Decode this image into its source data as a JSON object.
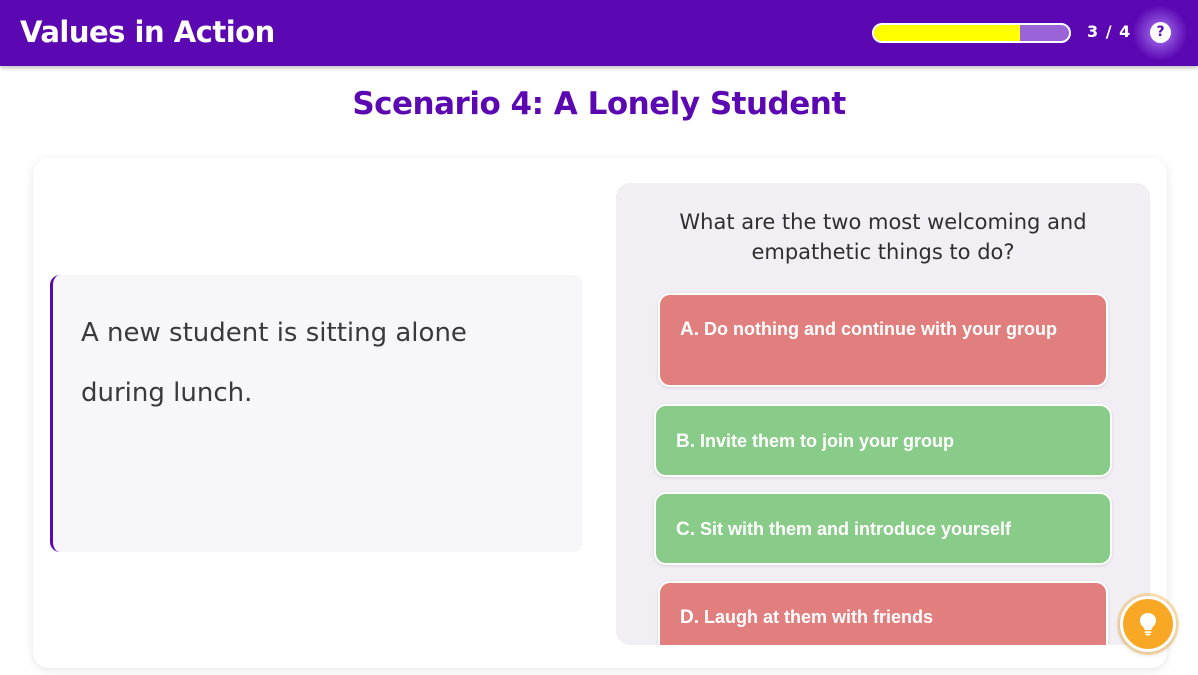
{
  "header": {
    "app_title": "Values in Action",
    "progress": {
      "current": 3,
      "total": 4,
      "fill_fraction": 0.75,
      "label": "3 / 4"
    },
    "help_label": "?"
  },
  "scenario": {
    "title": "Scenario 4: A Lonely Student",
    "description": "A new student is sitting alone during lunch."
  },
  "question": {
    "prompt": "What are the two most welcoming and empathetic things to do?",
    "options": [
      {
        "letter": "A.",
        "text": "Do nothing and continue with your group",
        "status_color": "#e07f7e"
      },
      {
        "letter": "B.",
        "text": "Invite them to join your group",
        "status_color": "#89cb88"
      },
      {
        "letter": "C.",
        "text": "Sit with them and introduce yourself",
        "status_color": "#89cb88"
      },
      {
        "letter": "D.",
        "text": "Laugh at them with friends",
        "status_color": "#e07f7e"
      }
    ]
  },
  "hint": {
    "icon": "lightbulb-icon"
  },
  "colors": {
    "brand": "#5c08b2",
    "progress_fill": "#ffff00",
    "correct": "#89cb88",
    "incorrect": "#e07f7e",
    "hint": "#f9a825"
  }
}
